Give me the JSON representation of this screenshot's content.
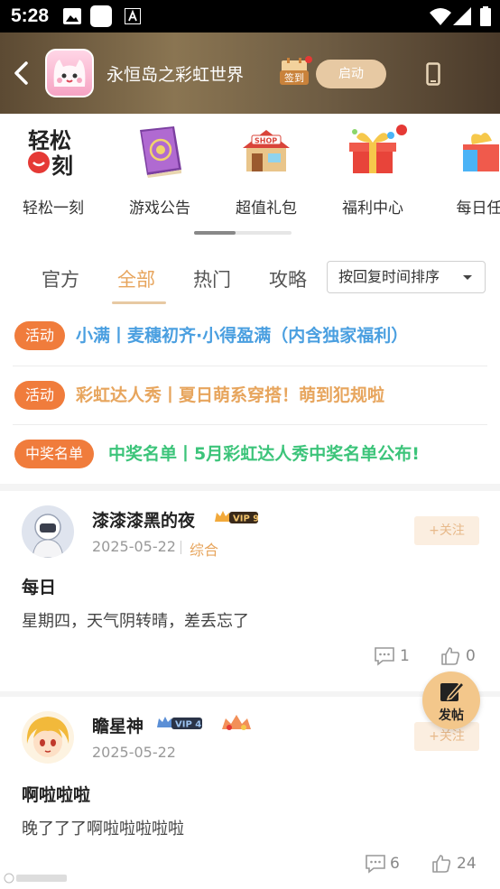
{
  "status_bar": {
    "time": "5:28"
  },
  "header": {
    "game_title": "永恒岛之彩虹世界",
    "signin_label": "签到",
    "launch_label": "启动"
  },
  "quick_menu": {
    "items": [
      {
        "label": "轻松一刻",
        "icon": "relax-logo-icon",
        "icon_text": "轻松一刻"
      },
      {
        "label": "游戏公告",
        "icon": "book-icon"
      },
      {
        "label": "超值礼包",
        "icon": "shop-icon",
        "icon_text": "SHOP"
      },
      {
        "label": "福利中心",
        "icon": "gift-icon",
        "badge": true
      },
      {
        "label": "每日任",
        "icon": "daily-gift-icon"
      }
    ]
  },
  "tabs": {
    "items": [
      "官方",
      "全部",
      "热门",
      "攻略"
    ],
    "active": "全部",
    "sort_label": "按回复时间排序"
  },
  "notices": [
    {
      "tag": "活动",
      "text": "小满丨麦穗初齐·小得盈满（内含独家福利）",
      "color": "#4a9fe0"
    },
    {
      "tag": "活动",
      "text": "彩虹达人秀丨夏日萌系穿搭！萌到犯规啦",
      "color": "#e7a55d"
    },
    {
      "tag": "中奖名单",
      "text": "中奖名单丨5月彩虹达人秀中奖名单公布!",
      "color": "#3cc47a"
    }
  ],
  "posts": [
    {
      "username": "漆漆漆黑的夜",
      "vip": "VIP 9",
      "date": "2025-05-22",
      "category": "综合",
      "follow": "+关注",
      "title": "每日",
      "body": "星期四，天气阴转晴，差丢忘了",
      "comments": "1",
      "likes": "0"
    },
    {
      "username": "瞻星神",
      "vip": "VIP 4",
      "date": "2025-05-22",
      "follow": "+关注",
      "title": "啊啦啦啦",
      "body": "晚了了了啊啦啦啦啦啦",
      "comments": "6",
      "likes": "24"
    }
  ],
  "fab": {
    "label": "发帖"
  },
  "colors": {
    "accent": "#e7a55d",
    "tag": "#f07c3c",
    "status_bar": "#000000"
  }
}
